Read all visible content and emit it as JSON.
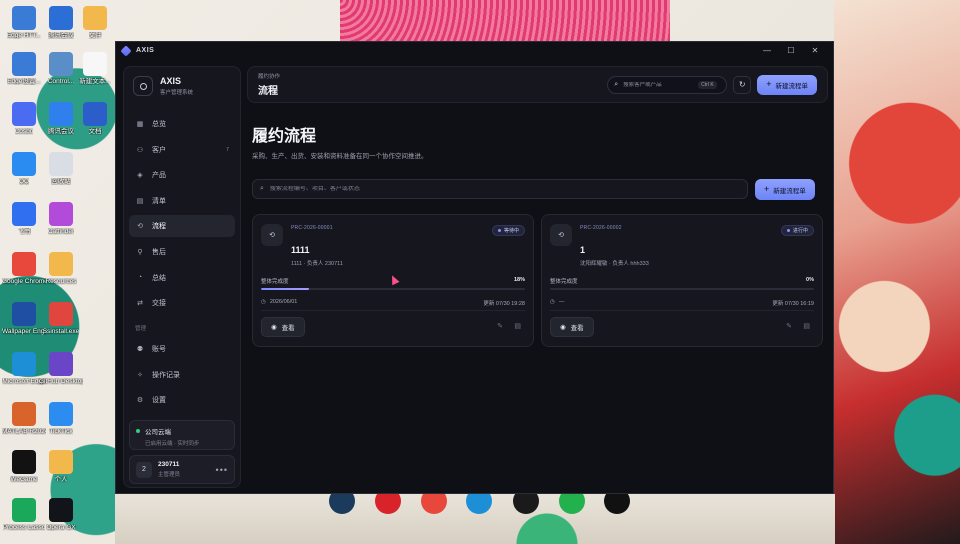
{
  "desktop": {
    "icons": [
      {
        "label": "Edge HTT...",
        "color": "#3a7bd5"
      },
      {
        "label": "腾讯会议",
        "color": "#2b6fd6"
      },
      {
        "label": "文件",
        "color": "#f2b84b"
      },
      {
        "label": "Edge设置...",
        "color": "#3a7bd5"
      },
      {
        "label": "Control...",
        "color": "#5a8ec9"
      },
      {
        "label": "新建文本...",
        "color": "#f7f7f7"
      },
      {
        "label": "Cosbo",
        "color": "#4b6cf2"
      },
      {
        "label": "腾讯会议",
        "color": "#2f80ed"
      },
      {
        "label": "文档",
        "color": "#2b5ec9"
      },
      {
        "label": "QQ",
        "color": "#2a8cf0"
      },
      {
        "label": "回收站",
        "color": "#d9dde4"
      },
      {
        "label": "飞书",
        "color": "#2f6ff0"
      },
      {
        "label": "Catfinder",
        "color": "#b24bd9"
      },
      {
        "label": "Google Chrome",
        "color": "#e8483b"
      },
      {
        "label": "Resources",
        "color": "#f2b84b"
      },
      {
        "label": "Wallpaper Engine",
        "color": "#1e4fa3"
      },
      {
        "label": "Ssinstall.exe",
        "color": "#e0463e"
      },
      {
        "label": "Microsoft Edge",
        "color": "#1d8fd6"
      },
      {
        "label": "GitHub Desktop",
        "color": "#6b45c7"
      },
      {
        "label": "MATLAB R2024b",
        "color": "#d9642b"
      },
      {
        "label": "TickTick",
        "color": "#2d8cf0"
      },
      {
        "label": "WeGame",
        "color": "#121212"
      },
      {
        "label": "个人",
        "color": "#f2b84b"
      },
      {
        "label": "Process Lasso",
        "color": "#1aa85a"
      },
      {
        "label": "Opera GX",
        "color": "#111418"
      }
    ],
    "taskbar": [
      {
        "name": "steam-icon",
        "color": "#1b3a5c"
      },
      {
        "name": "netease-music-icon",
        "color": "#d8232a"
      },
      {
        "name": "chrome-icon",
        "color": "#e8483b"
      },
      {
        "name": "edge-icon",
        "color": "#1d8fd6"
      },
      {
        "name": "qq-icon",
        "color": "#1a1a1a"
      },
      {
        "name": "wechat-icon",
        "color": "#22b14c"
      },
      {
        "name": "tiktok-icon",
        "color": "#111111"
      }
    ]
  },
  "window": {
    "title": "AXIS",
    "controls": {
      "minimize": "—",
      "maximize": "☐",
      "close": "✕"
    }
  },
  "sidebar": {
    "brand_name": "AXIS",
    "brand_sub": "客户管理系统",
    "items": [
      {
        "label": "总览",
        "icon": "▦",
        "name": "overview",
        "badge": ""
      },
      {
        "label": "客户",
        "icon": "⚇",
        "name": "customers",
        "badge": "7"
      },
      {
        "label": "产品",
        "icon": "◈",
        "name": "products",
        "badge": ""
      },
      {
        "label": "清单",
        "icon": "▤",
        "name": "checklist",
        "badge": ""
      },
      {
        "label": "流程",
        "icon": "⟲",
        "name": "workflow",
        "badge": "",
        "active": true
      },
      {
        "label": "售后",
        "icon": "⚲",
        "name": "after-sales",
        "badge": ""
      },
      {
        "label": "总结",
        "icon": "◔",
        "name": "summary",
        "badge": ""
      },
      {
        "label": "交接",
        "icon": "⇄",
        "name": "handover",
        "badge": ""
      }
    ],
    "section_label": "管理",
    "admin_items": [
      {
        "label": "账号",
        "icon": "⚉",
        "name": "account"
      },
      {
        "label": "操作记录",
        "icon": "✧",
        "name": "operation-log"
      },
      {
        "label": "设置",
        "icon": "⚙",
        "name": "settings"
      }
    ],
    "cloud": {
      "title": "公司云端",
      "sub": "已启用云端 · 实时同步"
    },
    "user": {
      "avatar": "2",
      "name": "230711",
      "role": "主管理员",
      "more": "•••"
    }
  },
  "header": {
    "breadcrumb": "履约协作",
    "title": "流程",
    "search_placeholder": "搜索客户或产品",
    "shortcut": "Ctrl K",
    "refresh_icon": "↻",
    "new_button": "新建流程单"
  },
  "main": {
    "title": "履约流程",
    "subtitle": "采购、生产、出货、安装和资料准备在同一个协作空间推进。",
    "filter_placeholder": "搜索流程编号、项目、客户或状态",
    "new_button": "新建流程单",
    "progress_label": "整体完成度",
    "view_label": "查看"
  },
  "cards": [
    {
      "code": "PRC-2026-00001",
      "status": "等待中",
      "name": "1111",
      "meta": "1111 · 负责人 230711",
      "progress": 0.18,
      "progress_text": "18%",
      "date": "2026/06/01",
      "updated": "更新 07/30 19:28"
    },
    {
      "code": "PRC-2026-00002",
      "status": "进行中",
      "name": "1",
      "meta": "沈阳辉耀敏 · 负责人 hhh333",
      "progress": 0,
      "progress_text": "0%",
      "date": "—",
      "updated": "更新 07/30 16:19"
    }
  ]
}
